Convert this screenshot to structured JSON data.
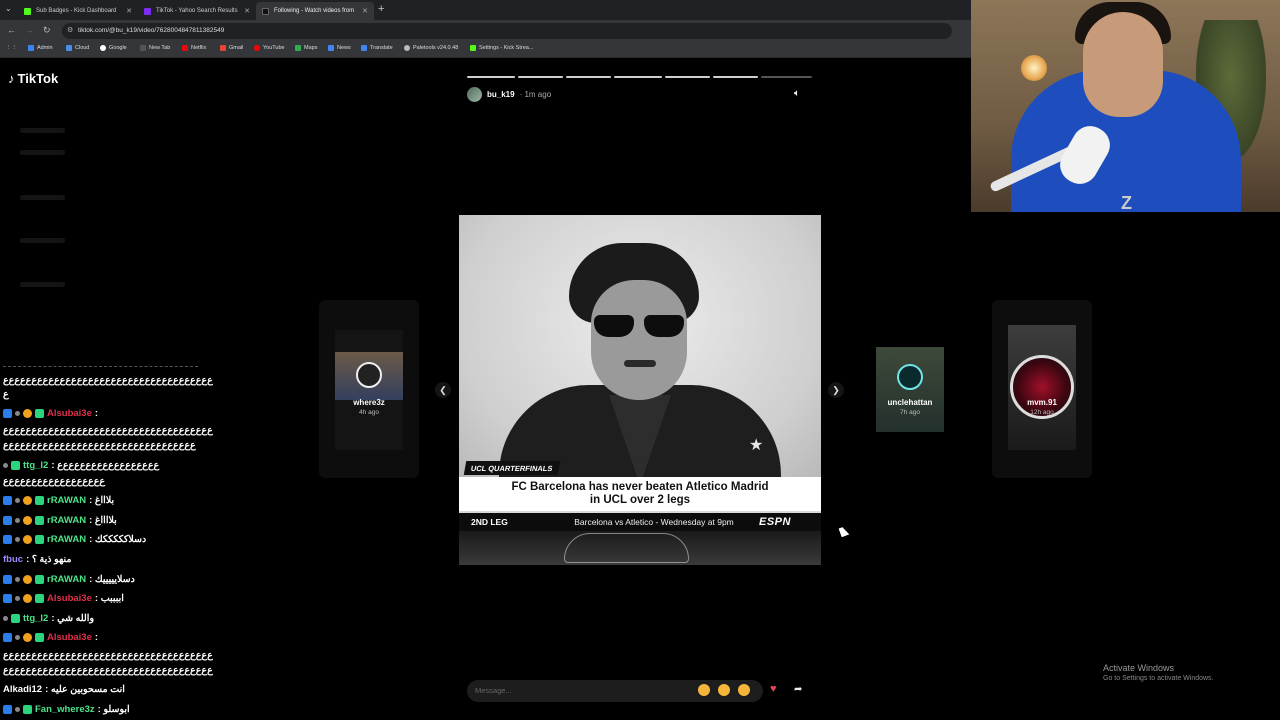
{
  "browser": {
    "tabs": [
      {
        "title": "Sub Badges - Kick Dashboard",
        "color": "#53fc18"
      },
      {
        "title": "TikTok - Yahoo Search Results",
        "color": "#7b2cf7"
      },
      {
        "title": "Following - Watch videos from",
        "color": "#111111"
      }
    ],
    "url": "tiktok.com/@bu_k19/video/7628004847811382549",
    "bookmarks": [
      "Admin",
      "Cloud",
      "Google",
      "New Tab",
      "Netflix",
      "Gmail",
      "YouTube",
      "Maps",
      "News",
      "Translate",
      "Paletools v24.0.48",
      "Settings - Kick Strea..."
    ]
  },
  "tiktok": {
    "logo": "TikTok",
    "story": {
      "author": "bu_k19",
      "ago": "· 1m ago",
      "tag": "UCL QUARTERFINALS",
      "headline_1": "FC Barcelona has never beaten Atletico Madrid",
      "headline_2": "in UCL over 2 legs",
      "leg": "2ND LEG",
      "match": "Barcelona vs Atletico - Wednesday at 9pm",
      "network": "ESPN"
    },
    "side_stories": [
      {
        "name": "where3z",
        "ago": "4h ago"
      },
      {
        "name": "unclehattan",
        "ago": "7h ago"
      },
      {
        "name": "mvm.91",
        "ago": "12h ago"
      }
    ],
    "message_placeholder": "Message..."
  },
  "chat": {
    "messages": [
      {
        "user": "",
        "text": "ﻉﻉﻉﻉﻉﻉﻉﻉﻉﻉﻉﻉﻉﻉﻉﻉﻉﻉﻉﻉﻉﻉﻉﻉﻉﻉﻉﻉﻉﻉﻉﻉﻉﻉﻉﻉﻉ"
      },
      {
        "user": "",
        "text": "ﻉ"
      },
      {
        "user": "Alsubai3e",
        "text": ":"
      },
      {
        "user": "",
        "text": "ﻉﻉﻉﻉﻉﻉﻉﻉﻉﻉﻉﻉﻉﻉﻉﻉﻉﻉﻉﻉﻉﻉﻉﻉﻉﻉﻉﻉﻉﻉﻉﻉﻉﻉﻉﻉﻉ"
      },
      {
        "user": "",
        "text": "ﻉﻉﻉﻉﻉﻉﻉﻉﻉﻉﻉﻉﻉﻉﻉﻉﻉﻉﻉﻉﻉﻉﻉﻉﻉﻉﻉﻉﻉﻉﻉﻉﻉﻉ"
      },
      {
        "user": "ttg_l2",
        "text": ": ﻉﻉﻉﻉﻉﻉﻉﻉﻉﻉﻉﻉﻉﻉﻉﻉﻉﻉ"
      },
      {
        "user": "",
        "text": "ﻉﻉﻉﻉﻉﻉﻉﻉﻉﻉﻉﻉﻉﻉﻉﻉﻉﻉ"
      },
      {
        "user": "rRAWAN",
        "text": ": بلاااغ"
      },
      {
        "user": "rRAWAN",
        "text": ": بلااااغ"
      },
      {
        "user": "rRAWAN",
        "text": ": دسلاكككككك"
      },
      {
        "user": "fbuc",
        "text": ": منهو ذية ؟"
      },
      {
        "user": "rRAWAN",
        "text": ": دسلايييييك"
      },
      {
        "user": "Alsubai3e",
        "text": ": اببببب"
      },
      {
        "user": "ttg_l2",
        "text": ": والله شي"
      },
      {
        "user": "Alsubai3e",
        "text": ":"
      },
      {
        "user": "",
        "text": "ﻉﻉﻉﻉﻉﻉﻉﻉﻉﻉﻉﻉﻉﻉﻉﻉﻉﻉﻉﻉﻉﻉﻉﻉﻉﻉﻉﻉﻉﻉﻉﻉﻉﻉﻉﻉﻉ"
      },
      {
        "user": "",
        "text": "ﻉﻉﻉﻉﻉﻉﻉﻉﻉﻉﻉﻉﻉﻉﻉﻉﻉﻉﻉﻉﻉﻉﻉﻉﻉﻉﻉﻉﻉﻉﻉﻉﻉﻉﻉﻉﻉ"
      },
      {
        "user": "Alkadi12",
        "text": ": انت مسحوبين عليه"
      },
      {
        "user": "Fan_where3z",
        "text": ": ابوسلو"
      }
    ]
  },
  "webcam": {
    "watermark": "Z"
  },
  "os": {
    "activate_title": "Activate Windows",
    "activate_sub": "Go to Settings to activate Windows."
  },
  "colors": {
    "kick_green": "#53fc18",
    "chat_red": "#e0304a",
    "chat_green": "#4de38a",
    "heart": "#e9445a"
  }
}
